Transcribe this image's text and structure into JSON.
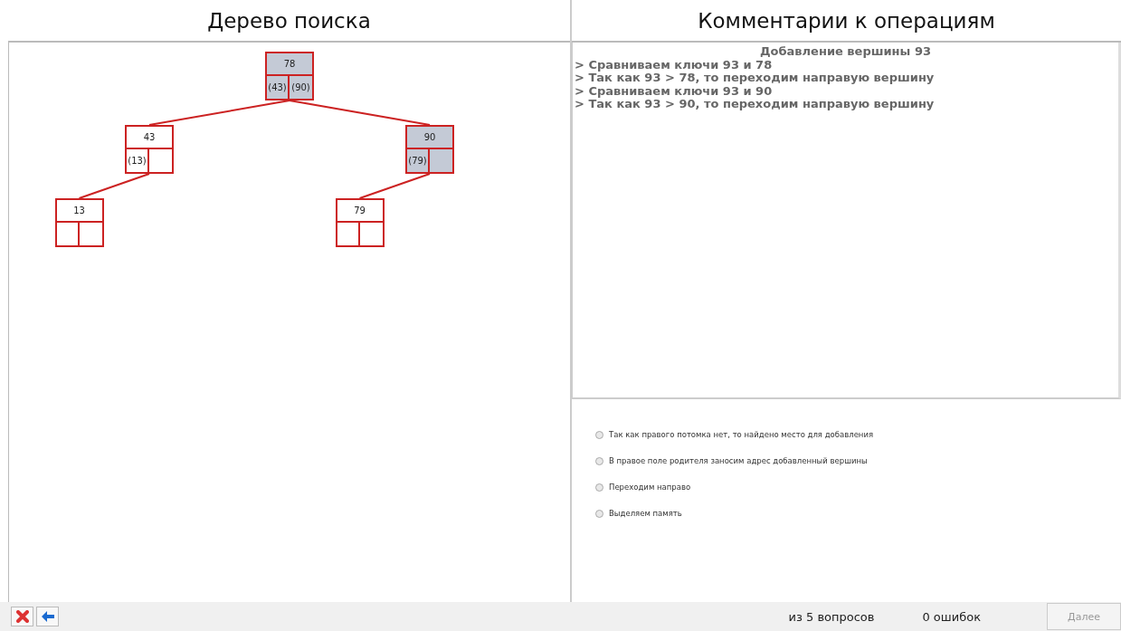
{
  "left_panel": {
    "title": "Дерево поиска"
  },
  "tree": {
    "key": "78",
    "left_label": "(43)",
    "right_label": "(90)",
    "highlighted": true,
    "left": {
      "key": "43",
      "left_label": "(13)",
      "highlighted": false,
      "left": {
        "key": "13",
        "highlighted": false
      }
    },
    "right": {
      "key": "90",
      "left_label": "(79)",
      "highlighted": true,
      "left": {
        "key": "79",
        "highlighted": false
      }
    }
  },
  "right_panel": {
    "title": "Комментарии к операциям"
  },
  "comments": {
    "heading": "Добавление вершины 93",
    "lines": [
      "> Сравниваем ключи 93 и 78",
      "> Так как 93 > 78, то переходим направую вершину",
      "> Сравниваем ключи 93 и 90",
      "> Так как 93 > 90, то переходим направую вершину"
    ]
  },
  "options": [
    {
      "label": "Так как правого потомка нет, то найдено место для добавления",
      "selected": false
    },
    {
      "label": "В правое поле родителя заносим адрес добавленный вершины",
      "selected": false
    },
    {
      "label": "Переходим направо",
      "selected": false
    },
    {
      "label": "Выделяем память",
      "selected": false
    }
  ],
  "footer": {
    "progress": "из 5 вопросов",
    "errors": "0 ошибок",
    "next_button": {
      "label": "Далее",
      "disabled": true
    }
  }
}
